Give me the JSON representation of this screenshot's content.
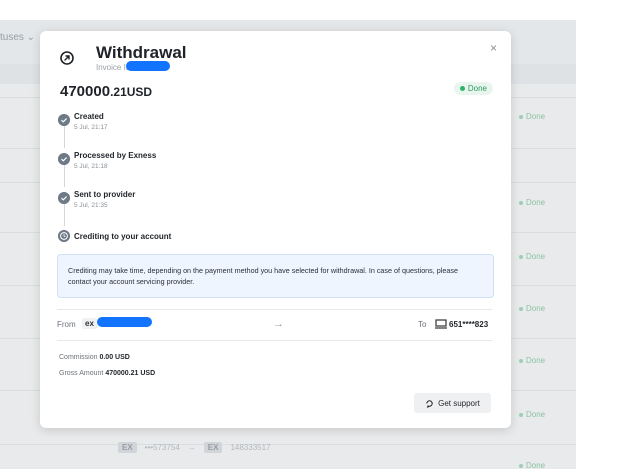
{
  "background": {
    "filter_label": "tuses ⌄",
    "row_status": "Done",
    "bottom": {
      "from_chip": "EX",
      "from_account": "•••573754",
      "to_chip": "EX",
      "to_account": "148333517"
    }
  },
  "modal": {
    "close_label": "×",
    "title": "Withdrawal",
    "invoice_label": "Invoice ID 1",
    "amount_integer": "470000",
    "amount_decimal": ".21",
    "currency": "USD",
    "status": "Done",
    "steps": [
      {
        "title": "Created",
        "time": "5 Jul, 21:17"
      },
      {
        "title": "Processed by Exness",
        "time": "5 Jul, 21:18"
      },
      {
        "title": "Sent to provider",
        "time": "5 Jul, 21:35"
      },
      {
        "title": "Crediting to your account",
        "time": ""
      }
    ],
    "info_text": "Crediting may take time, depending on the payment method you have selected for withdrawal. In case of questions, please contact your account servicing provider.",
    "from_label": "From",
    "from_account_chip": "ex",
    "to_label": "To",
    "to_account": "651****823",
    "commission_label": "Commission",
    "commission_value": "0.00 USD",
    "gross_label": "Gross Amount",
    "gross_value": "470000.21 USD",
    "support_label": "Get support"
  },
  "colors": {
    "accent_green": "#2fb36b",
    "redaction_blue": "#1273ff",
    "info_bg": "#eef5ff"
  }
}
